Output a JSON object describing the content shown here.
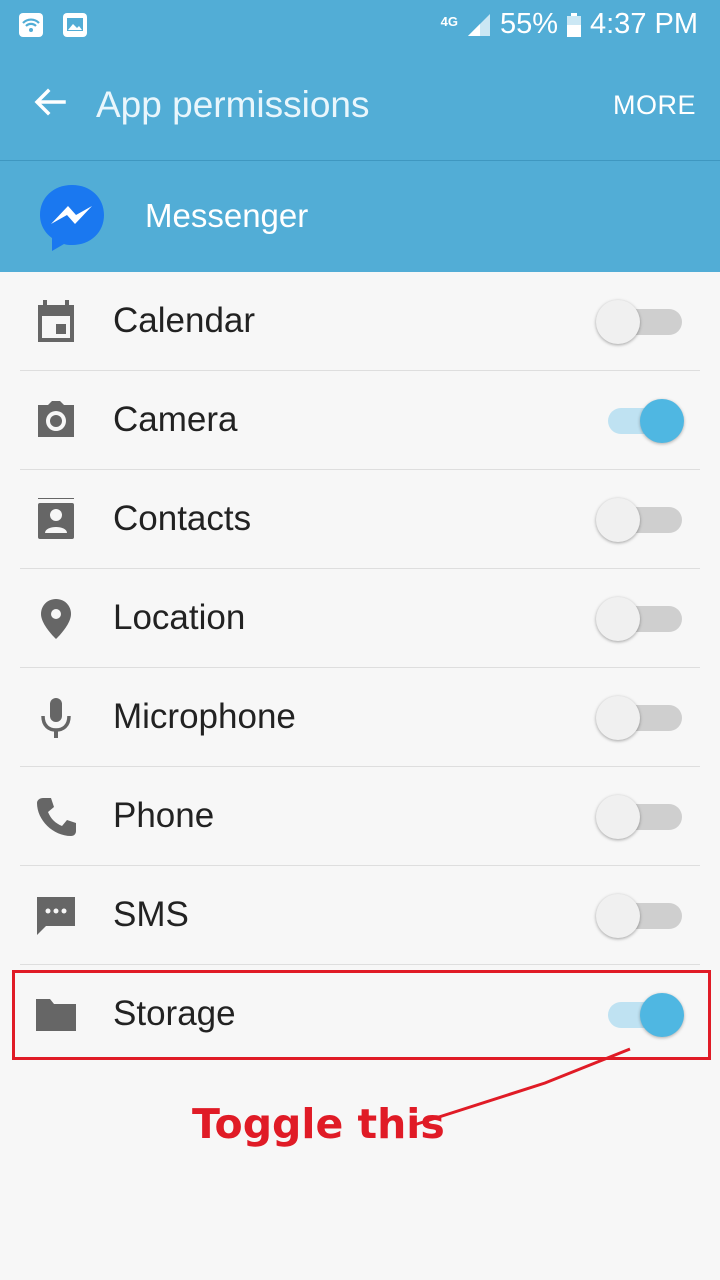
{
  "status_bar": {
    "network": "4G",
    "battery": "55%",
    "time": "4:37 PM"
  },
  "app_bar": {
    "title": "App permissions",
    "more_label": "MORE"
  },
  "app": {
    "name": "Messenger"
  },
  "permissions": [
    {
      "label": "Calendar",
      "icon": "calendar-icon",
      "enabled": false
    },
    {
      "label": "Camera",
      "icon": "camera-icon",
      "enabled": true
    },
    {
      "label": "Contacts",
      "icon": "contacts-icon",
      "enabled": false
    },
    {
      "label": "Location",
      "icon": "location-pin-icon",
      "enabled": false
    },
    {
      "label": "Microphone",
      "icon": "microphone-icon",
      "enabled": false
    },
    {
      "label": "Phone",
      "icon": "phone-icon",
      "enabled": false
    },
    {
      "label": "SMS",
      "icon": "sms-icon",
      "enabled": false
    },
    {
      "label": "Storage",
      "icon": "folder-icon",
      "enabled": true
    }
  ],
  "annotation": {
    "text": "Toggle this",
    "color": "#e01b26"
  },
  "colors": {
    "accent": "#52add6",
    "toggle_on": "#4fb7e2"
  }
}
